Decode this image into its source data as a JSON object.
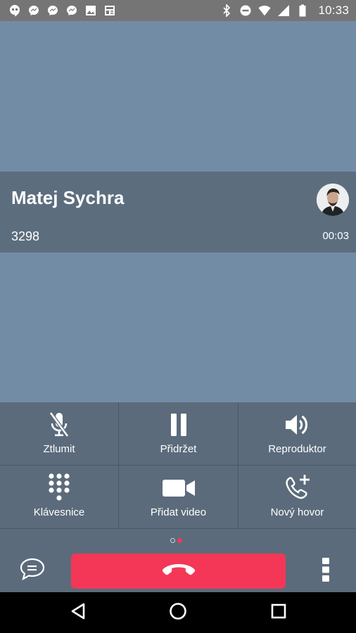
{
  "status_bar": {
    "time": "10:33",
    "left_icons": [
      "hangouts-icon",
      "messenger-icon",
      "messenger-icon",
      "messenger-icon",
      "image-icon",
      "news-icon"
    ],
    "right_icons": [
      "bluetooth-icon",
      "do-not-disturb-icon",
      "wifi-icon",
      "signal-icon",
      "battery-icon"
    ]
  },
  "call": {
    "name": "Matej Sychra",
    "number": "3298",
    "duration": "00:03"
  },
  "controls": [
    {
      "label": "Ztlumit",
      "icon": "mic-off-icon"
    },
    {
      "label": "Přidržet",
      "icon": "pause-icon"
    },
    {
      "label": "Reproduktor",
      "icon": "speaker-icon"
    },
    {
      "label": "Klávesnice",
      "icon": "dialpad-icon"
    },
    {
      "label": "Přidat video",
      "icon": "video-camera-icon"
    },
    {
      "label": "Nový hovor",
      "icon": "add-call-icon"
    }
  ],
  "pager": {
    "pages": 2,
    "active": 2
  },
  "colors": {
    "video_bg": "#738ca6",
    "info_bar": "#5c6d7e",
    "controls_bg": "#5b6b7b",
    "hangup": "#f43757",
    "status_bar": "#757575"
  }
}
